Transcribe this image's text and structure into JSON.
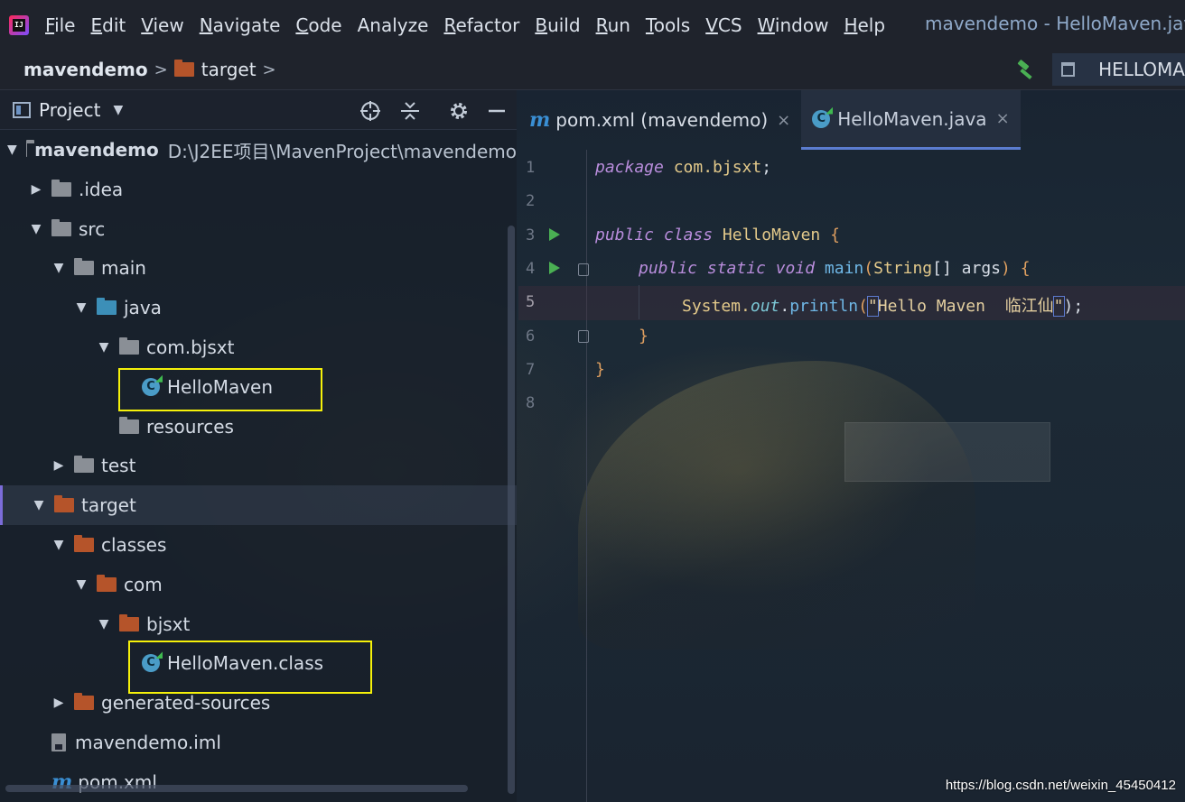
{
  "menubar": {
    "items": [
      {
        "label": "File",
        "underline": "F",
        "rest": "ile"
      },
      {
        "label": "Edit",
        "underline": "E",
        "rest": "dit"
      },
      {
        "label": "View",
        "underline": "V",
        "rest": "iew"
      },
      {
        "label": "Navigate",
        "underline": "N",
        "rest": "avigate"
      },
      {
        "label": "Code",
        "underline": "C",
        "rest": "ode"
      },
      {
        "label": "Analyze",
        "underline": "",
        "rest": "Analyze"
      },
      {
        "label": "Refactor",
        "underline": "R",
        "rest": "efactor"
      },
      {
        "label": "Build",
        "underline": "B",
        "rest": "uild"
      },
      {
        "label": "Run",
        "underline": "R",
        "rest": "un"
      },
      {
        "label": "Tools",
        "underline": "T",
        "rest": "ools"
      },
      {
        "label": "VCS",
        "underline": "V",
        "rest": "CS"
      },
      {
        "label": "Window",
        "underline": "W",
        "rest": "indow"
      },
      {
        "label": "Help",
        "underline": "H",
        "rest": "elp"
      }
    ],
    "window_title": "mavendemo - HelloMaven.java"
  },
  "breadcrumb": {
    "root": "mavendemo",
    "sep": ">",
    "child": "target",
    "run_config": "HELLOMA"
  },
  "project_panel": {
    "title": "Project",
    "dropdown": "▼",
    "tree": [
      {
        "label": "mavendemo",
        "path": "D:\\J2EE项目\\MavenProject\\mavendemo",
        "arrow": "▼",
        "bold": true,
        "icon": "module-icon"
      },
      {
        "label": ".idea",
        "arrow": "▶",
        "icon": "folder-gray"
      },
      {
        "label": "src",
        "arrow": "▼",
        "icon": "folder-gray"
      },
      {
        "label": "main",
        "arrow": "▼",
        "icon": "folder-gray"
      },
      {
        "label": "java",
        "arrow": "▼",
        "icon": "folder-blue"
      },
      {
        "label": "com.bjsxt",
        "arrow": "▼",
        "icon": "package-icon"
      },
      {
        "label": "HelloMaven",
        "arrow": "",
        "icon": "java-class-icon"
      },
      {
        "label": "resources",
        "arrow": "",
        "icon": "resources-folder-icon"
      },
      {
        "label": "test",
        "arrow": "▶",
        "icon": "folder-gray"
      },
      {
        "label": "target",
        "arrow": "▼",
        "icon": "folder-orange"
      },
      {
        "label": "classes",
        "arrow": "▼",
        "icon": "folder-orange"
      },
      {
        "label": "com",
        "arrow": "▼",
        "icon": "folder-orange"
      },
      {
        "label": "bjsxt",
        "arrow": "▼",
        "icon": "folder-orange"
      },
      {
        "label": "HelloMaven.class",
        "arrow": "",
        "icon": "java-class-icon"
      },
      {
        "label": "generated-sources",
        "arrow": "▶",
        "icon": "folder-orange"
      },
      {
        "label": "mavendemo.iml",
        "arrow": "",
        "icon": "iml-file-icon"
      },
      {
        "label": "pom.xml",
        "arrow": "",
        "icon": "maven-icon"
      }
    ]
  },
  "editor": {
    "tabs": [
      {
        "label": "pom.xml (mavendemo)",
        "close": "×",
        "icon": "m"
      },
      {
        "label": "HelloMaven.java",
        "close": "×"
      }
    ],
    "line_numbers": [
      "1",
      "2",
      "3",
      "4",
      "5",
      "6",
      "7",
      "8"
    ],
    "code": {
      "l1_kw": "package",
      "l1_pkg": " com.bjsxt",
      "l1_end": ";",
      "l3_kw": "public class",
      "l3_cls": " HelloMaven",
      "l3_brace": " {",
      "l4_kw": "public static void",
      "l4_fn": " main",
      "l4_open": "(",
      "l4_type": "String",
      "l4_arr": "[]",
      "l4_param": " args",
      "l4_close": ") ",
      "l4_brace": "{",
      "l5_sys": "System.",
      "l5_out": "out",
      "l5_dot": ".",
      "l5_fn": "println",
      "l5_open": "(",
      "l5_q1": "\"",
      "l5_str": "Hello Maven  临江仙",
      "l5_q2": "\"",
      "l5_end": ");",
      "l6_brace": "}",
      "l7_brace": "}"
    }
  },
  "watermark": "https://blog.csdn.net/weixin_45450412",
  "colors": {
    "accent": "#5b7ccf",
    "highlight": "#f5f10a",
    "run": "#4ab053"
  }
}
